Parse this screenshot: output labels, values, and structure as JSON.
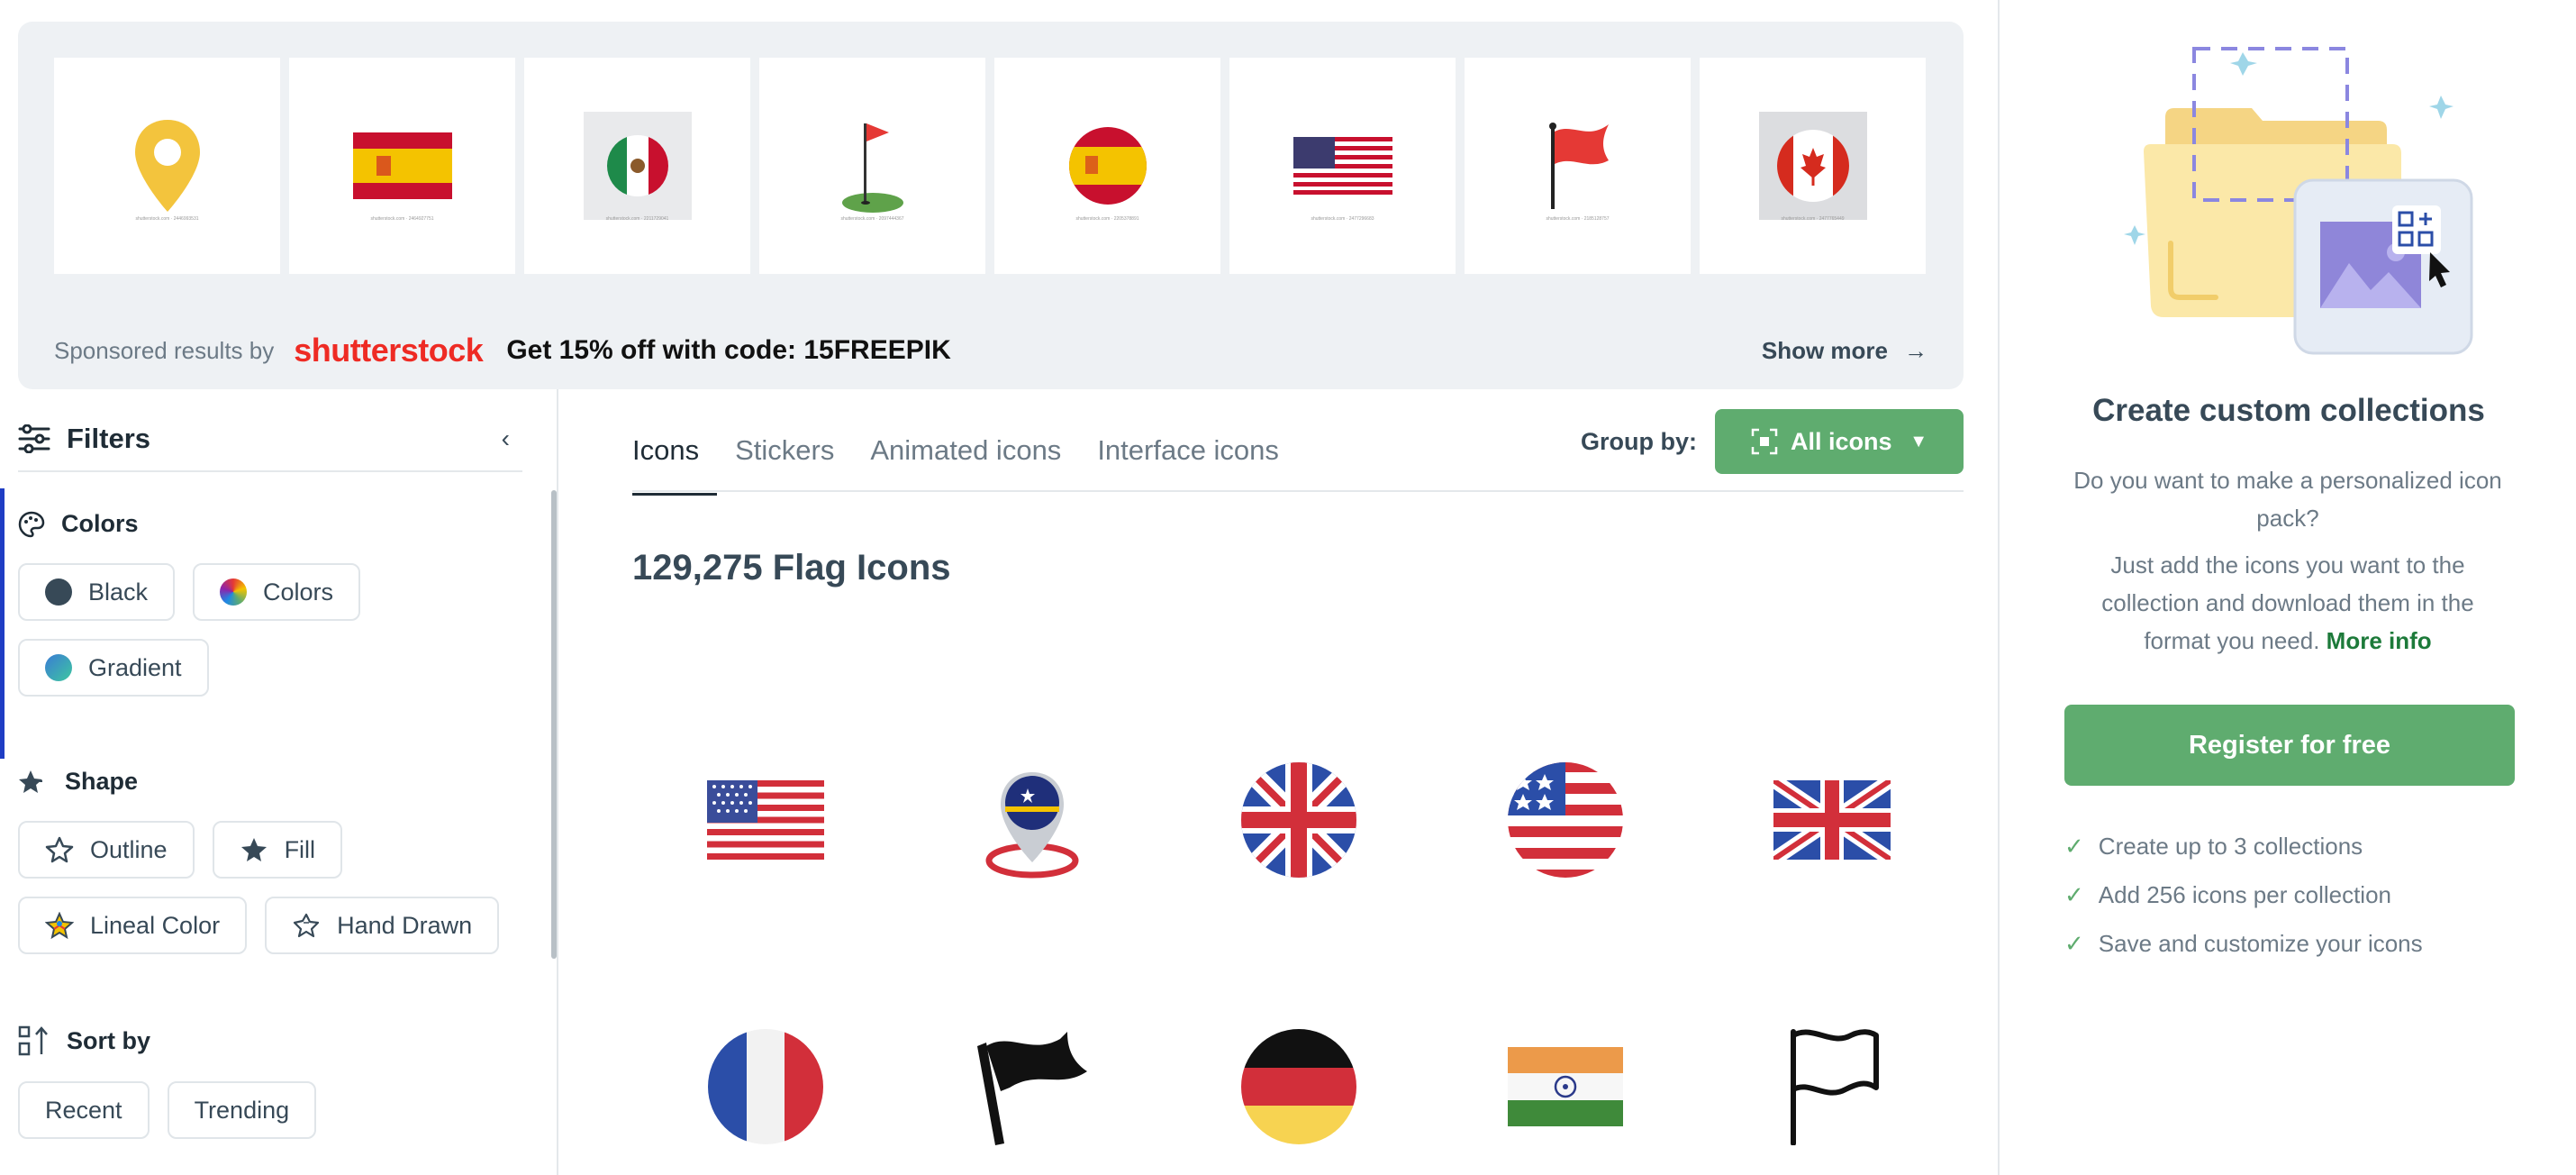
{
  "sponsored": {
    "label": "Sponsored results by",
    "brand": "shutterstock",
    "promo": "Get 15% off with code: 15FREEPIK",
    "show_more": "Show more",
    "thumbnails": [
      {
        "icon": "location-pin-icon"
      },
      {
        "icon": "spain-flag-icon"
      },
      {
        "icon": "mexico-flag-icon"
      },
      {
        "icon": "golf-flag-icon"
      },
      {
        "icon": "spain-round-flag-icon"
      },
      {
        "icon": "usa-flag-icon"
      },
      {
        "icon": "red-flag-icon"
      },
      {
        "icon": "canada-round-flag-icon"
      }
    ]
  },
  "filters": {
    "title": "Filters",
    "colors": {
      "title": "Colors",
      "options": [
        "Black",
        "Colors",
        "Gradient"
      ]
    },
    "shape": {
      "title": "Shape",
      "options": [
        "Outline",
        "Fill",
        "Lineal Color",
        "Hand Drawn"
      ]
    },
    "sort": {
      "title": "Sort by",
      "options": [
        "Recent",
        "Trending"
      ]
    }
  },
  "main": {
    "tabs": [
      "Icons",
      "Stickers",
      "Animated icons",
      "Interface icons"
    ],
    "active_tab": "Icons",
    "group_by_label": "Group by:",
    "group_by_value": "All icons",
    "result_title": "129,275 Flag Icons",
    "icons": [
      "usa-flag-icon",
      "curacao-location-pin-icon",
      "uk-round-flag-icon",
      "usa-round-flag-icon",
      "uk-flag-icon",
      "france-round-flag-icon",
      "black-flag-icon",
      "germany-round-flag-icon",
      "india-flag-icon",
      "outline-flag-icon"
    ]
  },
  "collections": {
    "title": "Create custom collections",
    "desc1": "Do you want to make a personalized icon pack?",
    "desc2": "Just add the icons you want to the collection and download them in the format you need.",
    "more_info": "More info",
    "register": "Register for free",
    "benefits": [
      "Create up to 3 collections",
      "Add 256 icons per collection",
      "Save and customize your icons"
    ]
  },
  "colors": {
    "accent_green": "#5fac6f",
    "brand_red": "#ee2b24",
    "text_dark": "#1f2c36",
    "text_muted": "#6c7a86"
  }
}
